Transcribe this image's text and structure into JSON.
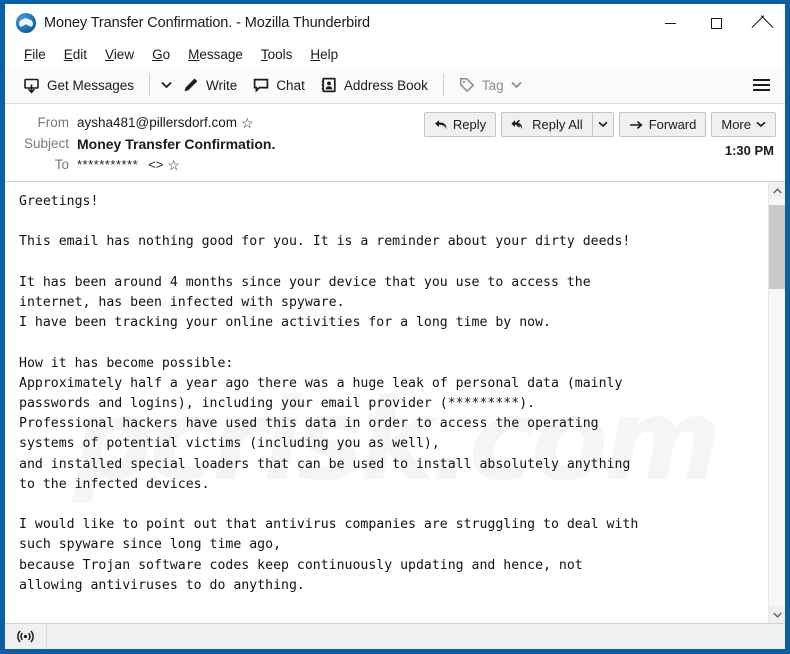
{
  "window": {
    "title": "Money Transfer Confirmation. - Mozilla Thunderbird",
    "app_icon": "thunderbird-icon",
    "border_color": "#0b5fa5",
    "controls": {
      "minimize": "minimize-icon",
      "maximize": "maximize-icon",
      "close": "close-icon"
    }
  },
  "menubar": {
    "items": [
      {
        "label": "File",
        "accesskey": "F"
      },
      {
        "label": "Edit",
        "accesskey": "E"
      },
      {
        "label": "View",
        "accesskey": "V"
      },
      {
        "label": "Go",
        "accesskey": "G"
      },
      {
        "label": "Message",
        "accesskey": "M"
      },
      {
        "label": "Tools",
        "accesskey": "T"
      },
      {
        "label": "Help",
        "accesskey": "H"
      }
    ]
  },
  "toolbar": {
    "get_messages": "Get Messages",
    "get_messages_icon": "inbox-download-icon",
    "get_messages_dropdown": "chevron-down-icon",
    "write": "Write",
    "write_icon": "pencil-icon",
    "chat": "Chat",
    "chat_icon": "speech-bubble-icon",
    "address_book": "Address Book",
    "address_book_icon": "address-book-icon",
    "tag": "Tag",
    "tag_icon": "tag-icon",
    "tag_dropdown": "chevron-down-icon",
    "app_menu_icon": "hamburger-menu-icon"
  },
  "message_header": {
    "from_label": "From",
    "from_value": "aysha481@pillersdorf.com",
    "from_star_icon": "star-icon",
    "subject_label": "Subject",
    "subject_value": "Money Transfer Confirmation.",
    "to_label": "To",
    "to_value": "***********",
    "to_brackets": "<>",
    "to_star_icon": "star-icon",
    "timestamp": "1:30 PM",
    "actions": {
      "reply": "Reply",
      "reply_icon": "reply-arrow-icon",
      "reply_all": "Reply All",
      "reply_all_icon": "reply-all-arrow-icon",
      "reply_all_dropdown": "chevron-down-icon",
      "forward": "Forward",
      "forward_icon": "forward-arrow-icon",
      "more": "More",
      "more_dropdown": "chevron-down-icon"
    }
  },
  "message_body": {
    "watermark": "pcrisk.com",
    "text": "Greetings!\n\nThis email has nothing good for you. It is a reminder about your dirty deeds!\n\nIt has been around 4 months since your device that you use to access the\ninternet, has been infected with spyware.\nI have been tracking your online activities for a long time by now.\n\nHow it has become possible:\nApproximately half a year ago there was a huge leak of personal data (mainly\npasswords and logins), including your email provider (*********).\nProfessional hackers have used this data in order to access the operating\nsystems of potential victims (including you as well),\nand installed special loaders that can be used to install absolutely anything\nto the infected devices.\n\nI would like to point out that antivirus companies are struggling to deal with\nsuch spyware since long time ago,\nbecause Trojan software codes keep continuously updating and hence, not\nallowing antiviruses to do anything."
  },
  "scrollbar": {
    "up_arrow": "scroll-up-icon",
    "down_arrow": "scroll-down-icon",
    "thumb_position_pct": 2
  },
  "statusbar": {
    "indicator_icon": "broadcast-icon"
  }
}
